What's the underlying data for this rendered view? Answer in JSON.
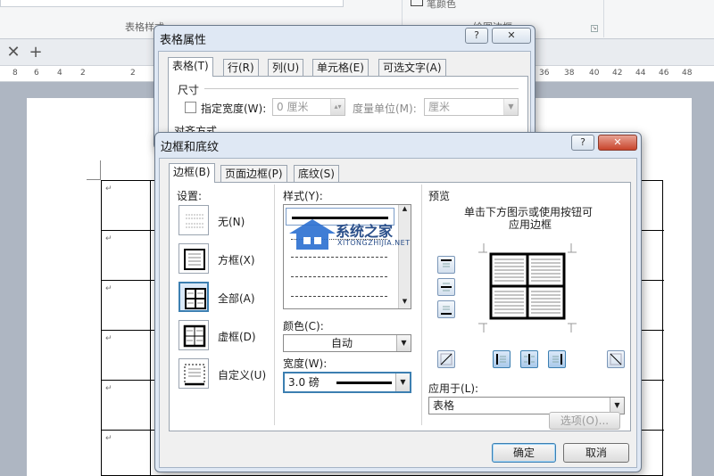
{
  "ribbon": {
    "group_table_style": "表格样式",
    "group_draw_border": "绘图边框",
    "top_label": "笔颜色"
  },
  "tabbar": {
    "close_glyph": "✕",
    "add_glyph": "+"
  },
  "ruler": {
    "left_ticks": [
      "8",
      "6",
      "4",
      "2",
      "2"
    ],
    "right_ticks": [
      "36",
      "38",
      "40",
      "42",
      "44",
      "46",
      "48"
    ]
  },
  "table_properties": {
    "title": "表格属性",
    "help_glyph": "?",
    "close_glyph": "✕",
    "tabs": [
      {
        "label": "表格(T)"
      },
      {
        "label": "行(R)"
      },
      {
        "label": "列(U)"
      },
      {
        "label": "单元格(E)"
      },
      {
        "label": "可选文字(A)"
      }
    ],
    "size_heading": "尺寸",
    "specify_width_label": "指定宽度(W):",
    "width_value": "0 厘米",
    "measure_unit_label": "度量单位(M):",
    "measure_unit_value": "厘米",
    "alignment_heading": "对齐方式"
  },
  "borders_shading": {
    "title": "边框和底纹",
    "help_glyph": "?",
    "close_glyph": "✕",
    "tabs": [
      {
        "label": "边框(B)"
      },
      {
        "label": "页面边框(P)"
      },
      {
        "label": "底纹(S)"
      }
    ],
    "setting_heading": "设置:",
    "settings": [
      {
        "label": "无(N)"
      },
      {
        "label": "方框(X)"
      },
      {
        "label": "全部(A)"
      },
      {
        "label": "虚框(D)"
      },
      {
        "label": "自定义(U)"
      }
    ],
    "style_heading": "样式(Y):",
    "color_label": "颜色(C):",
    "color_value": "自动",
    "width_label": "宽度(W):",
    "width_value": "3.0 磅",
    "preview_heading": "预览",
    "preview_hint_line1": "单击下方图示或使用按钮可",
    "preview_hint_line2": "应用边框",
    "apply_to_label": "应用于(L):",
    "apply_to_value": "表格",
    "options_button": "选项(O)...",
    "ok_button": "确定",
    "cancel_button": "取消"
  },
  "watermark": {
    "brand_cn": "系统之家",
    "brand_url": "XITONGZHIJIA.NET"
  },
  "colors": {
    "accent": "#3c7fb1",
    "dialog_frame": "#dfe8f4",
    "watermark_blue": "#2a6fd0"
  }
}
